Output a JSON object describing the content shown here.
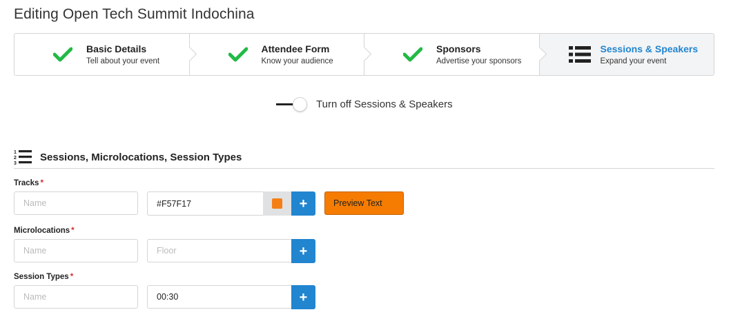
{
  "page": {
    "title": "Editing Open Tech Summit Indochina"
  },
  "steps": [
    {
      "title": "Basic Details",
      "desc": "Tell about your event",
      "icon": "checkmark-icon",
      "state": "completed"
    },
    {
      "title": "Attendee Form",
      "desc": "Know your audience",
      "icon": "checkmark-icon",
      "state": "completed"
    },
    {
      "title": "Sponsors",
      "desc": "Advertise your sponsors",
      "icon": "checkmark-icon",
      "state": "completed"
    },
    {
      "title": "Sessions & Speakers",
      "desc": "Expand your event",
      "icon": "list-icon",
      "state": "active"
    }
  ],
  "toggle": {
    "label": "Turn off Sessions & Speakers",
    "on": true
  },
  "section": {
    "title": "Sessions, Microlocations, Session Types",
    "icon": "ordered-list-icon"
  },
  "tracks": {
    "label": "Tracks",
    "required_marker": "*",
    "name_placeholder": "Name",
    "color_value": "#F57F17",
    "add_label": "+",
    "preview_label": "Preview Text"
  },
  "microlocations": {
    "label": "Microlocations",
    "required_marker": "*",
    "name_placeholder": "Name",
    "floor_placeholder": "Floor",
    "add_label": "+"
  },
  "session_types": {
    "label": "Session Types",
    "required_marker": "*",
    "name_placeholder": "Name",
    "length_value": "00:30",
    "add_label": "+"
  },
  "colors": {
    "check_green": "#21ba45",
    "active_blue": "#2185d0",
    "track_color": "#F57F17",
    "preview_bg": "#F57C00",
    "required_red": "#db2828"
  }
}
